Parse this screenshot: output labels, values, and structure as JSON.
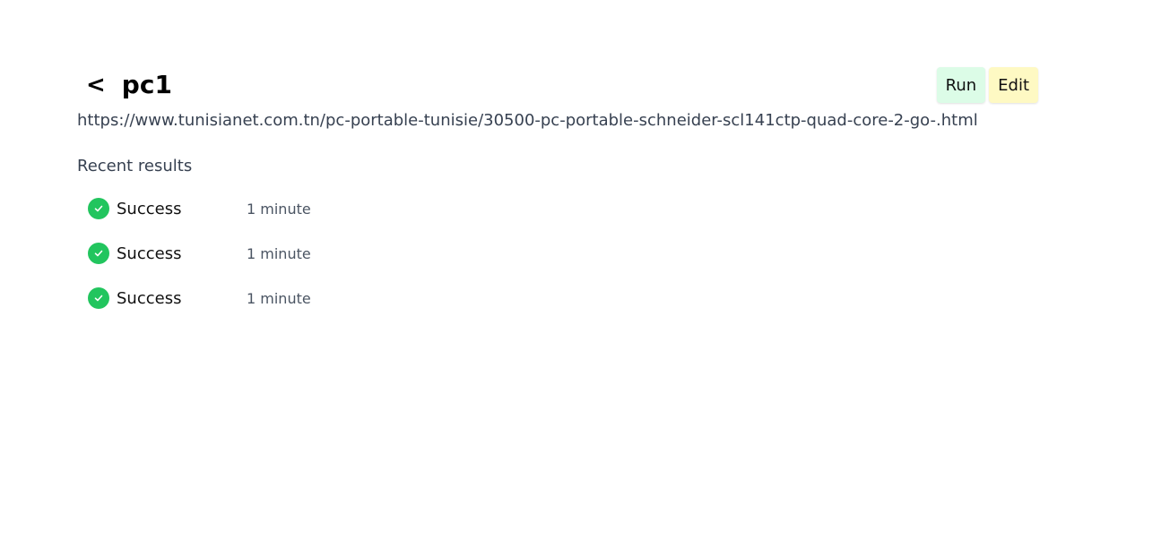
{
  "header": {
    "back_label": "<",
    "title": "pc1",
    "run_label": "Run",
    "edit_label": "Edit"
  },
  "url": "https://www.tunisianet.com.tn/pc-portable-tunisie/30500-pc-portable-schneider-scl141ctp-quad-core-2-go-.html",
  "recent": {
    "title": "Recent results",
    "items": [
      {
        "icon": "check-circle-icon",
        "status": "Success",
        "time": "1 minute"
      },
      {
        "icon": "check-circle-icon",
        "status": "Success",
        "time": "1 minute"
      },
      {
        "icon": "check-circle-icon",
        "status": "Success",
        "time": "1 minute"
      }
    ]
  },
  "colors": {
    "success": "#22c55e",
    "run_bg": "#dcfce7",
    "edit_bg": "#fef9c3"
  }
}
